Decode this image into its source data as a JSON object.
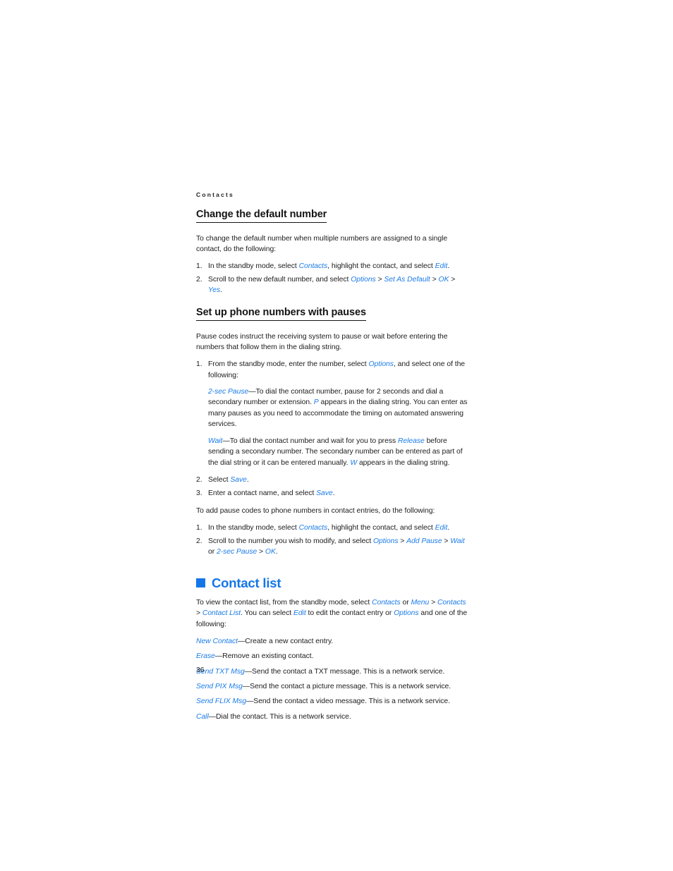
{
  "document": {
    "running_head": "Contacts",
    "page_number": "36",
    "accent_color": "#1476e8",
    "link_color": "#1c7ce8",
    "body_color": "#1d1d1d"
  },
  "sections": [
    {
      "id": "change-default-number",
      "heading": "Change the default number",
      "intro": "To change the default number when multiple numbers are assigned to a single contact, do the following:",
      "steps": [
        {
          "parts": [
            {
              "t": "text",
              "v": "In the standby mode, select "
            },
            {
              "t": "ui",
              "v": "Contacts"
            },
            {
              "t": "text",
              "v": ", highlight the contact, and select "
            },
            {
              "t": "ui",
              "v": "Edit"
            },
            {
              "t": "text",
              "v": "."
            }
          ]
        },
        {
          "parts": [
            {
              "t": "text",
              "v": "Scroll to the new default number, and select "
            },
            {
              "t": "ui",
              "v": "Options"
            },
            {
              "t": "text",
              "v": " > "
            },
            {
              "t": "ui",
              "v": "Set As Default"
            },
            {
              "t": "text",
              "v": " > "
            },
            {
              "t": "ui",
              "v": "OK"
            },
            {
              "t": "text",
              "v": " > "
            },
            {
              "t": "ui",
              "v": "Yes"
            },
            {
              "t": "text",
              "v": "."
            }
          ]
        }
      ]
    },
    {
      "id": "set-up-phone-numbers-with-pauses",
      "heading": "Set up phone numbers with pauses",
      "intro": "Pause codes instruct the receiving system to pause or wait before entering the numbers that follow them in the dialing string.",
      "steps": [
        {
          "parts": [
            {
              "t": "text",
              "v": "From the standby mode, enter the number, select "
            },
            {
              "t": "ui",
              "v": "Options"
            },
            {
              "t": "text",
              "v": ", and select one of the following:"
            }
          ]
        }
      ],
      "definitions": [
        {
          "parts": [
            {
              "t": "ui",
              "v": "2-sec Pause"
            },
            {
              "t": "text",
              "v": "—To dial the contact number, pause for 2 seconds and dial a secondary number or extension. "
            },
            {
              "t": "ui",
              "v": "P"
            },
            {
              "t": "text",
              "v": " appears in the dialing string. You can enter as many pauses as you need to accommodate the timing on automated answering services."
            }
          ]
        },
        {
          "parts": [
            {
              "t": "ui",
              "v": "Wait"
            },
            {
              "t": "text",
              "v": "—To dial the contact number and wait for you to press "
            },
            {
              "t": "ui",
              "v": "Release"
            },
            {
              "t": "text",
              "v": " before sending a secondary number. The secondary number can be entered as part of the dial string or it can be entered manually. "
            },
            {
              "t": "ui",
              "v": "W"
            },
            {
              "t": "text",
              "v": " appears in the dialing string."
            }
          ]
        }
      ],
      "steps_continued": [
        {
          "number": "2.",
          "parts": [
            {
              "t": "text",
              "v": "Select "
            },
            {
              "t": "ui",
              "v": "Save"
            },
            {
              "t": "text",
              "v": "."
            }
          ]
        },
        {
          "number": "3.",
          "parts": [
            {
              "t": "text",
              "v": "Enter a contact name, and select "
            },
            {
              "t": "ui",
              "v": "Save"
            },
            {
              "t": "text",
              "v": "."
            }
          ]
        }
      ],
      "intro2": "To add pause codes to phone numbers in contact entries, do the following:",
      "steps2": [
        {
          "parts": [
            {
              "t": "text",
              "v": "In the standby mode, select "
            },
            {
              "t": "ui",
              "v": "Contacts"
            },
            {
              "t": "text",
              "v": ", highlight the contact, and select "
            },
            {
              "t": "ui",
              "v": "Edit"
            },
            {
              "t": "text",
              "v": "."
            }
          ]
        },
        {
          "parts": [
            {
              "t": "text",
              "v": "Scroll to the number you wish to modify, and select "
            },
            {
              "t": "ui",
              "v": "Options"
            },
            {
              "t": "text",
              "v": " > "
            },
            {
              "t": "ui",
              "v": "Add Pause"
            },
            {
              "t": "text",
              "v": " > "
            },
            {
              "t": "ui",
              "v": "Wait"
            },
            {
              "t": "text",
              "v": " or "
            },
            {
              "t": "ui",
              "v": "2-sec Pause"
            },
            {
              "t": "text",
              "v": " > "
            },
            {
              "t": "ui",
              "v": "OK"
            },
            {
              "t": "text",
              "v": "."
            }
          ]
        }
      ]
    }
  ],
  "chapter": {
    "id": "contact-list",
    "bullet_icon": "blue-square-bullet-icon",
    "heading": "Contact list",
    "intro": [
      {
        "t": "text",
        "v": "To view the contact list, from the standby mode, select "
      },
      {
        "t": "ui",
        "v": "Contacts"
      },
      {
        "t": "text",
        "v": " or "
      },
      {
        "t": "ui",
        "v": "Menu"
      },
      {
        "t": "text",
        "v": " > "
      },
      {
        "t": "ui",
        "v": "Contacts"
      },
      {
        "t": "text",
        "v": " > "
      },
      {
        "t": "ui",
        "v": "Contact List"
      },
      {
        "t": "text",
        "v": ". You can select "
      },
      {
        "t": "ui",
        "v": "Edit"
      },
      {
        "t": "text",
        "v": " to edit the contact entry or "
      },
      {
        "t": "ui",
        "v": "Options"
      },
      {
        "t": "text",
        "v": " and one of the following:"
      }
    ],
    "options": [
      {
        "term": "New Contact",
        "parts": [
          {
            "t": "ui",
            "v": "New Contact"
          },
          {
            "t": "text",
            "v": "—Create a new contact entry."
          }
        ]
      },
      {
        "term": "Erase",
        "parts": [
          {
            "t": "ui",
            "v": "Erase"
          },
          {
            "t": "text",
            "v": "—Remove an existing contact."
          }
        ]
      },
      {
        "term": "Send TXT Msg",
        "parts": [
          {
            "t": "ui",
            "v": "Send TXT Msg"
          },
          {
            "t": "text",
            "v": "—Send the contact a TXT message. This is a network service."
          }
        ]
      },
      {
        "term": "Send PIX Msg",
        "parts": [
          {
            "t": "ui",
            "v": "Send PIX Msg"
          },
          {
            "t": "text",
            "v": "—Send the contact a picture message. This is a network service."
          }
        ]
      },
      {
        "term": "Send FLIX Msg",
        "parts": [
          {
            "t": "ui",
            "v": "Send FLIX Msg"
          },
          {
            "t": "text",
            "v": "—Send the contact a video message. This is a network service."
          }
        ]
      },
      {
        "term": "Call",
        "parts": [
          {
            "t": "ui",
            "v": "Call"
          },
          {
            "t": "text",
            "v": "—Dial the contact. This is a network service."
          }
        ]
      }
    ]
  }
}
